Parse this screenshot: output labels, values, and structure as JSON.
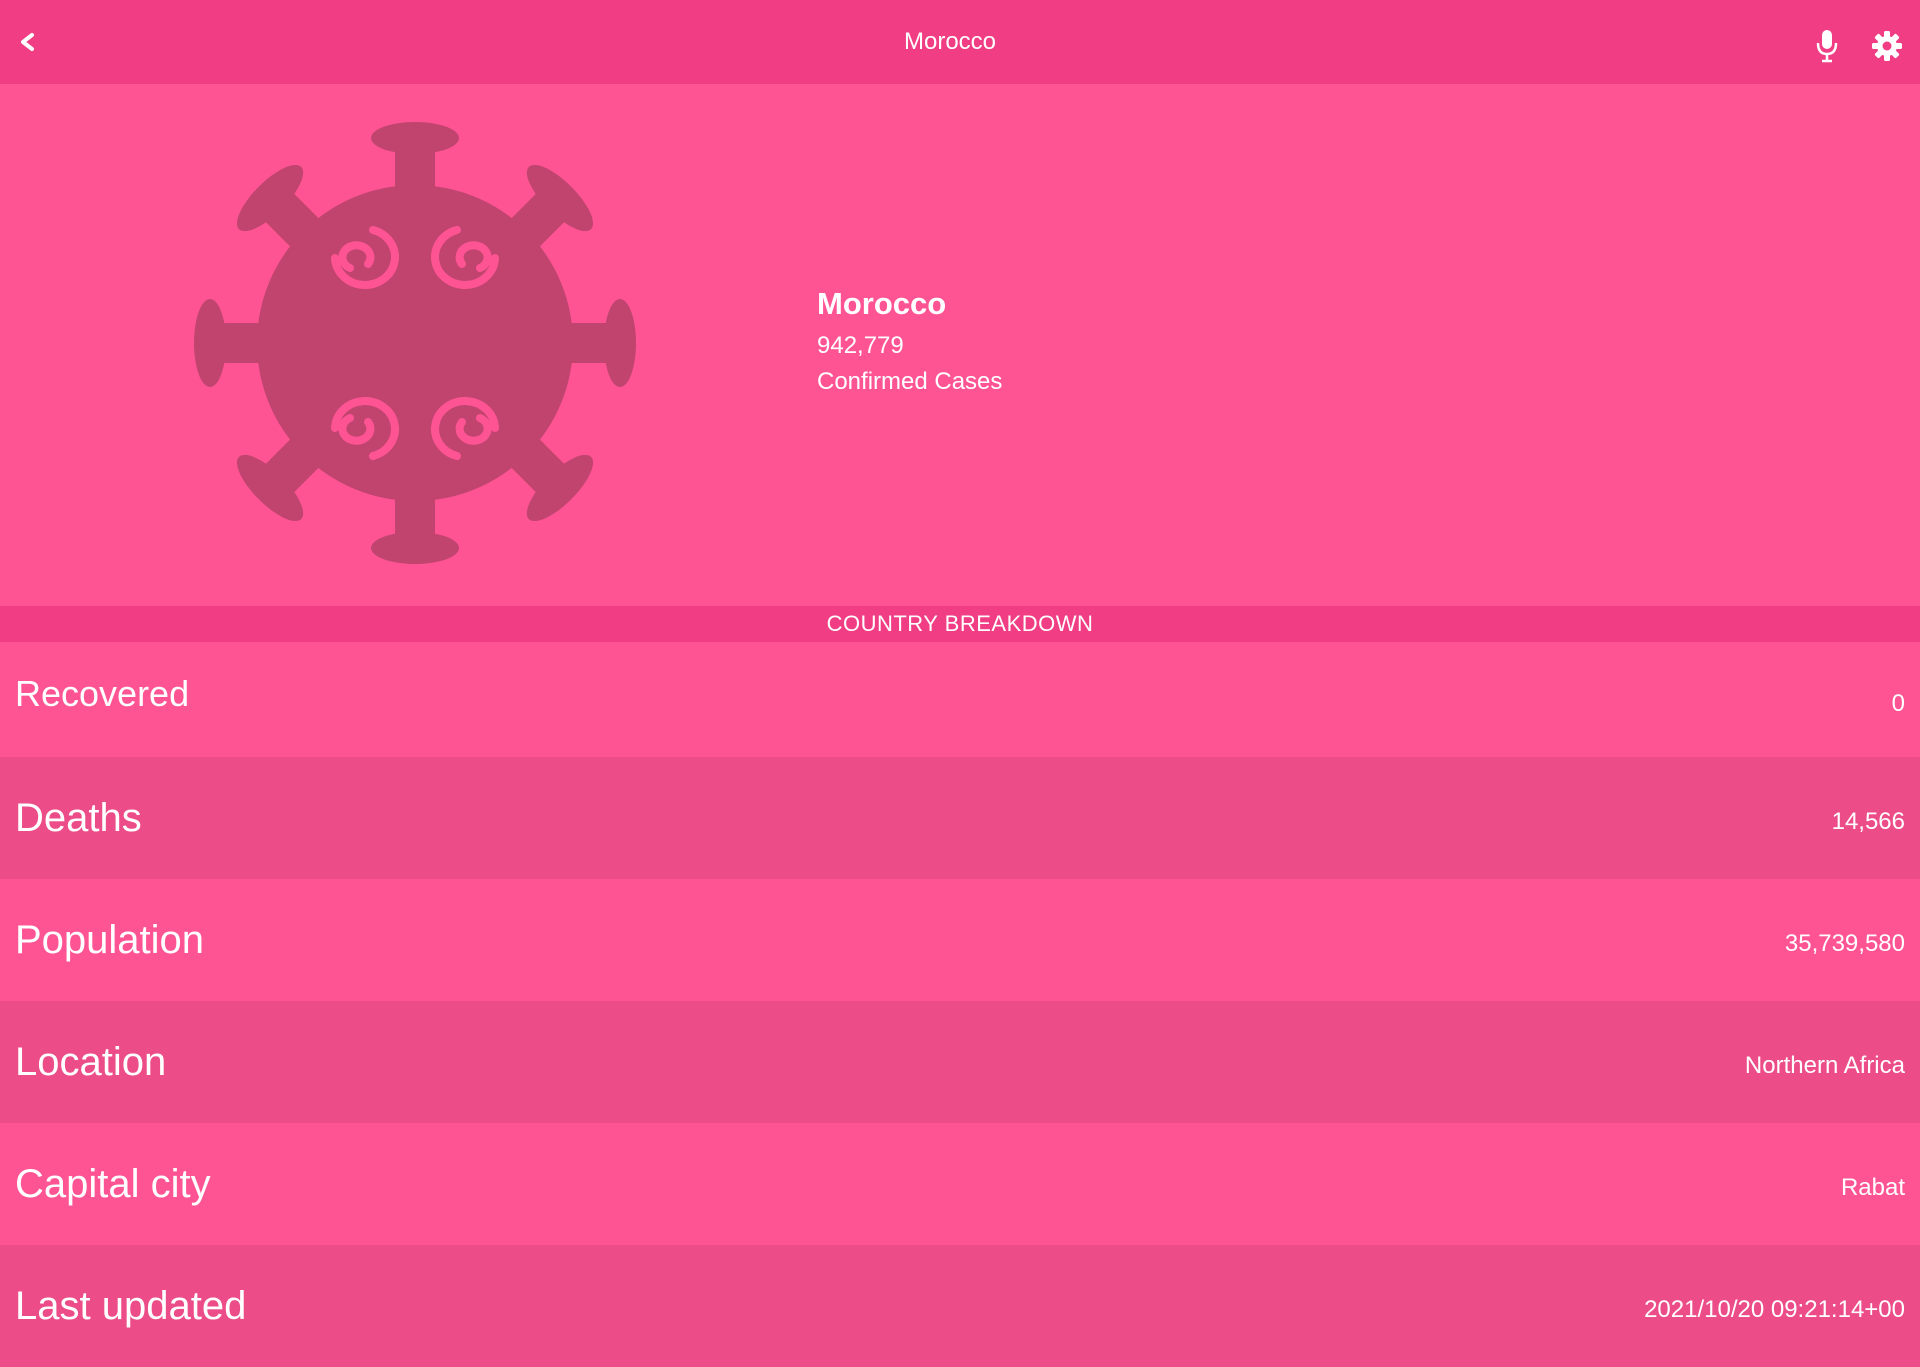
{
  "header": {
    "title": "Morocco",
    "back_label": "<",
    "icons": {
      "back": "back-chevron-icon",
      "mic": "microphone-icon",
      "settings": "gear-icon"
    }
  },
  "hero": {
    "illustration": "virus-icon",
    "country": "Morocco",
    "confirmed_cases": "942,779",
    "confirmed_caption": "Confirmed Cases"
  },
  "section": {
    "title": "COUNTRY BREAKDOWN"
  },
  "breakdown": {
    "items": [
      {
        "label": "Recovered",
        "value": "0"
      },
      {
        "label": "Deaths",
        "value": "14,566"
      },
      {
        "label": "Population",
        "value": "35,739,580"
      },
      {
        "label": "Location",
        "value": "Northern Africa"
      },
      {
        "label": "Capital city",
        "value": "Rabat"
      },
      {
        "label": "Last updated",
        "value": "2021/10/20 09:21:14+00"
      }
    ]
  },
  "colors": {
    "background": "#ff5494",
    "bar": "#f03d83",
    "row_alt": "#ec4c88",
    "virus": "#c0446e",
    "text": "#ffffff"
  }
}
